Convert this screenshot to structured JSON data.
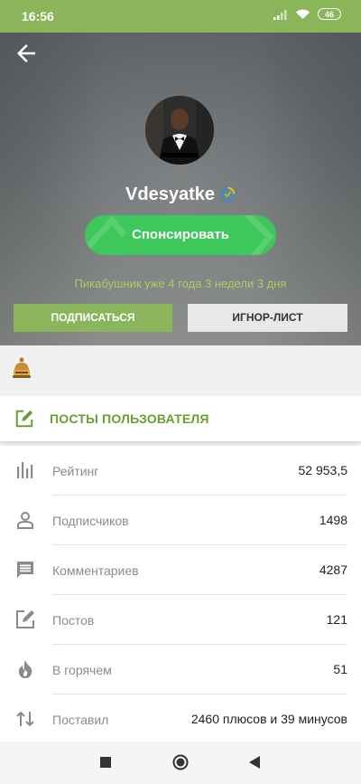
{
  "status_bar": {
    "time": "16:56",
    "battery": "46"
  },
  "profile": {
    "username": "Vdesyatke",
    "sponsor_label": "Спонсировать",
    "since": "Пикабушник уже 4 года 3 недели 3 дня",
    "subscribe_label": "ПОДПИСАТЬСЯ",
    "ignore_label": "ИГНОР-ЛИСТ"
  },
  "posts_tab": {
    "label": "ПОСТЫ ПОЛЬЗОВАТЕЛЯ"
  },
  "stats": [
    {
      "icon": "bar-chart-icon",
      "label": "Рейтинг",
      "value": "52 953,5"
    },
    {
      "icon": "person-icon",
      "label": "Подписчиков",
      "value": "1498"
    },
    {
      "icon": "comment-icon",
      "label": "Комментариев",
      "value": "4287"
    },
    {
      "icon": "edit-icon",
      "label": "Постов",
      "value": "121"
    },
    {
      "icon": "fire-icon",
      "label": "В горячем",
      "value": "51"
    },
    {
      "icon": "swap-vertical-icon",
      "label": "Поставил",
      "value": "2460 плюсов и 39 минусов"
    }
  ],
  "colors": {
    "accent": "#8ab55a",
    "sponsor": "#3ec75a",
    "tab_text": "#6a9e33"
  }
}
